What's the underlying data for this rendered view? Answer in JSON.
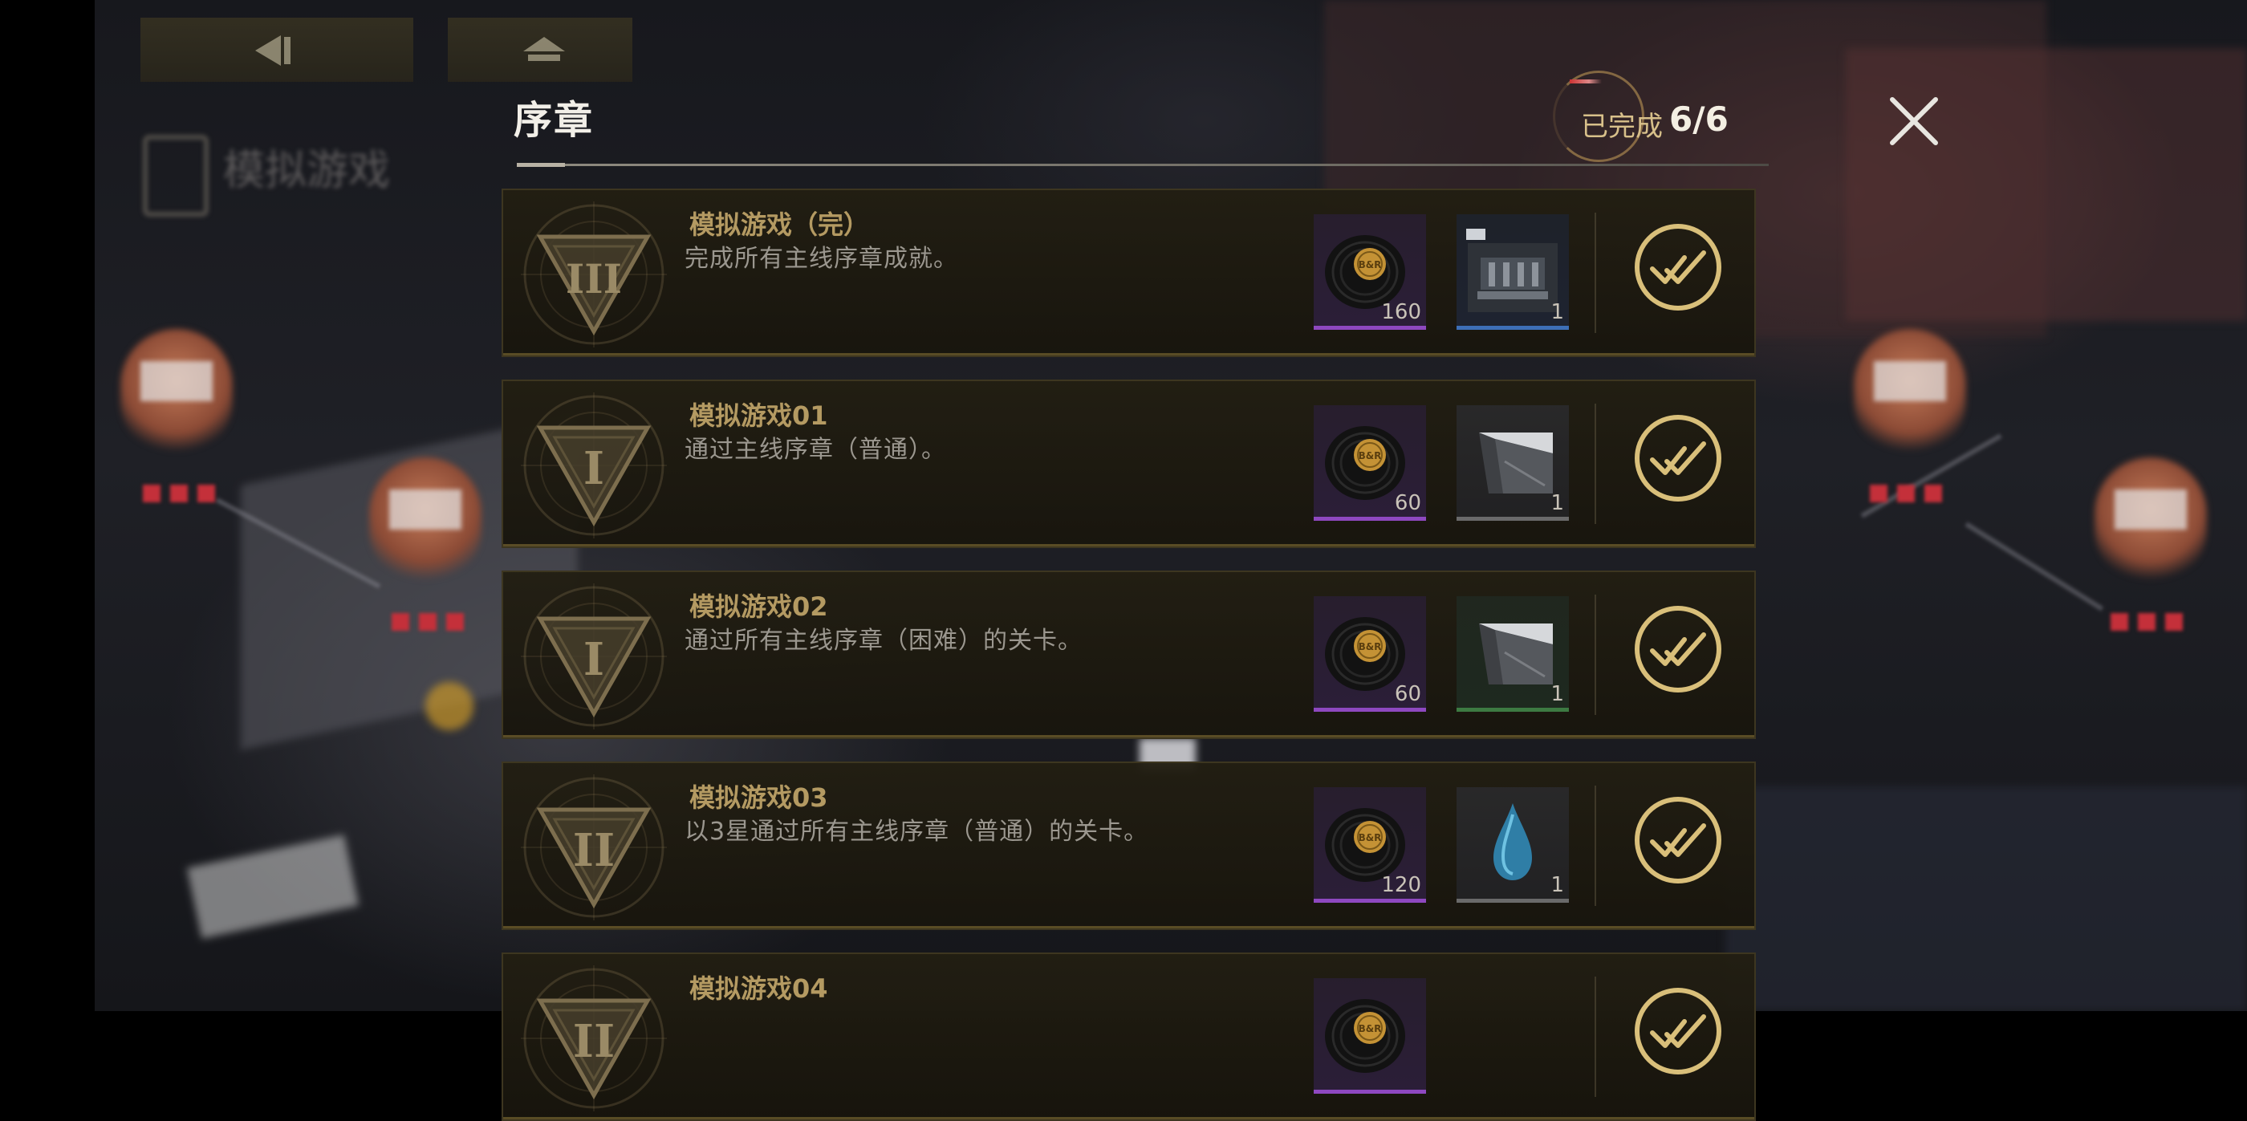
{
  "background": {
    "stage_name": "模拟游戏"
  },
  "panel": {
    "title": "序章",
    "progress_label": "已完成",
    "progress_value": "6/6"
  },
  "achievements": [
    {
      "title": "模拟游戏（完）",
      "description": "完成所有主线序章成就。",
      "emblem": "emblem-tier-iii-icon",
      "rewards": [
        {
          "icon": "vinyl-record-icon",
          "qty": "160",
          "rarity": "purple"
        },
        {
          "icon": "stage-ticket-icon",
          "qty": "1",
          "rarity": "blue"
        }
      ],
      "completed": true
    },
    {
      "title": "模拟游戏01",
      "description": "通过主线序章（普通）。",
      "emblem": "emblem-tier-i-icon",
      "rewards": [
        {
          "icon": "vinyl-record-icon",
          "qty": "60",
          "rarity": "purple"
        },
        {
          "icon": "data-card-icon",
          "qty": "1",
          "rarity": "gray"
        }
      ],
      "completed": true
    },
    {
      "title": "模拟游戏02",
      "description": "通过所有主线序章（困难）的关卡。",
      "emblem": "emblem-tier-i-icon",
      "rewards": [
        {
          "icon": "vinyl-record-icon",
          "qty": "60",
          "rarity": "purple"
        },
        {
          "icon": "data-card-icon",
          "qty": "1",
          "rarity": "green"
        }
      ],
      "completed": true
    },
    {
      "title": "模拟游戏03",
      "description": "以3星通过所有主线序章（普通）的关卡。",
      "emblem": "emblem-tier-ii-icon",
      "rewards": [
        {
          "icon": "vinyl-record-icon",
          "qty": "120",
          "rarity": "purple"
        },
        {
          "icon": "water-drop-icon",
          "qty": "1",
          "rarity": "gray"
        }
      ],
      "completed": true
    },
    {
      "title": "模拟游戏04",
      "description": "",
      "emblem": "emblem-tier-ii-icon",
      "rewards": [
        {
          "icon": "vinyl-record-icon",
          "qty": "",
          "rarity": "purple"
        }
      ],
      "completed": true
    }
  ],
  "colors": {
    "accent_gold": "#d9bf7a",
    "title_gold": "#b49a62",
    "rarity_purple": "#8e48c0",
    "rarity_blue": "#3d6fb7",
    "rarity_green": "#3d7a42"
  }
}
